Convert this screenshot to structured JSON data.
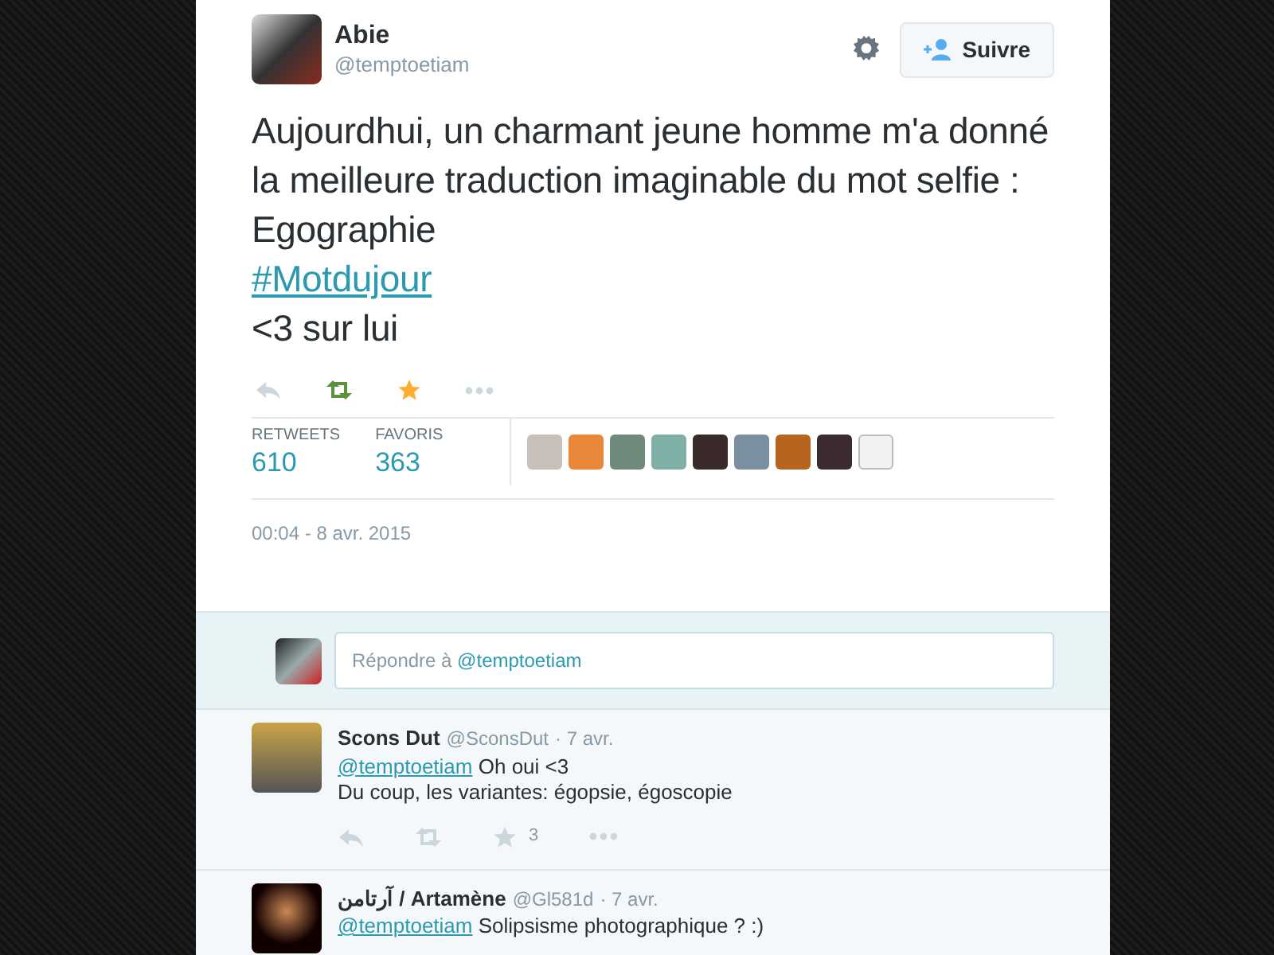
{
  "author": {
    "name": "Abie",
    "handle": "@temptoetiam"
  },
  "follow_button": {
    "label": "Suivre"
  },
  "tweet": {
    "segments": [
      {
        "kind": "text",
        "text": "Aujourdhui, un charmant jeune homme m'a donné la meilleure traduction imaginable du mot selfie :"
      },
      {
        "kind": "text",
        "text": "Egographie"
      },
      {
        "kind": "hashtag",
        "text": "#Motdujour"
      },
      {
        "kind": "text",
        "text": "<3 sur lui"
      }
    ],
    "retweeted": true,
    "favorited": true
  },
  "stats": [
    {
      "label": "RETWEETS",
      "value": "610"
    },
    {
      "label": "FAVORIS",
      "value": "363"
    }
  ],
  "timestamp": "00:04 - 8 avr. 2015",
  "reply_box": {
    "placeholder": "Répondre à",
    "mention": "@temptoetiam"
  },
  "replies": [
    {
      "name": "Scons Dut",
      "handle": "@SconsDut",
      "time": "· 7 avr.",
      "mention": "@temptoetiam",
      "lines": [
        "Oh oui <3",
        "Du coup, les variantes: égopsie, égoscopie"
      ],
      "fav_count": "3"
    },
    {
      "name": "آرتامن / Artamène",
      "handle": "@Gl581d",
      "time": "· 7 avr.",
      "mention": "@temptoetiam",
      "lines": [
        "Solipsisme photographique ? :)"
      ]
    }
  ]
}
